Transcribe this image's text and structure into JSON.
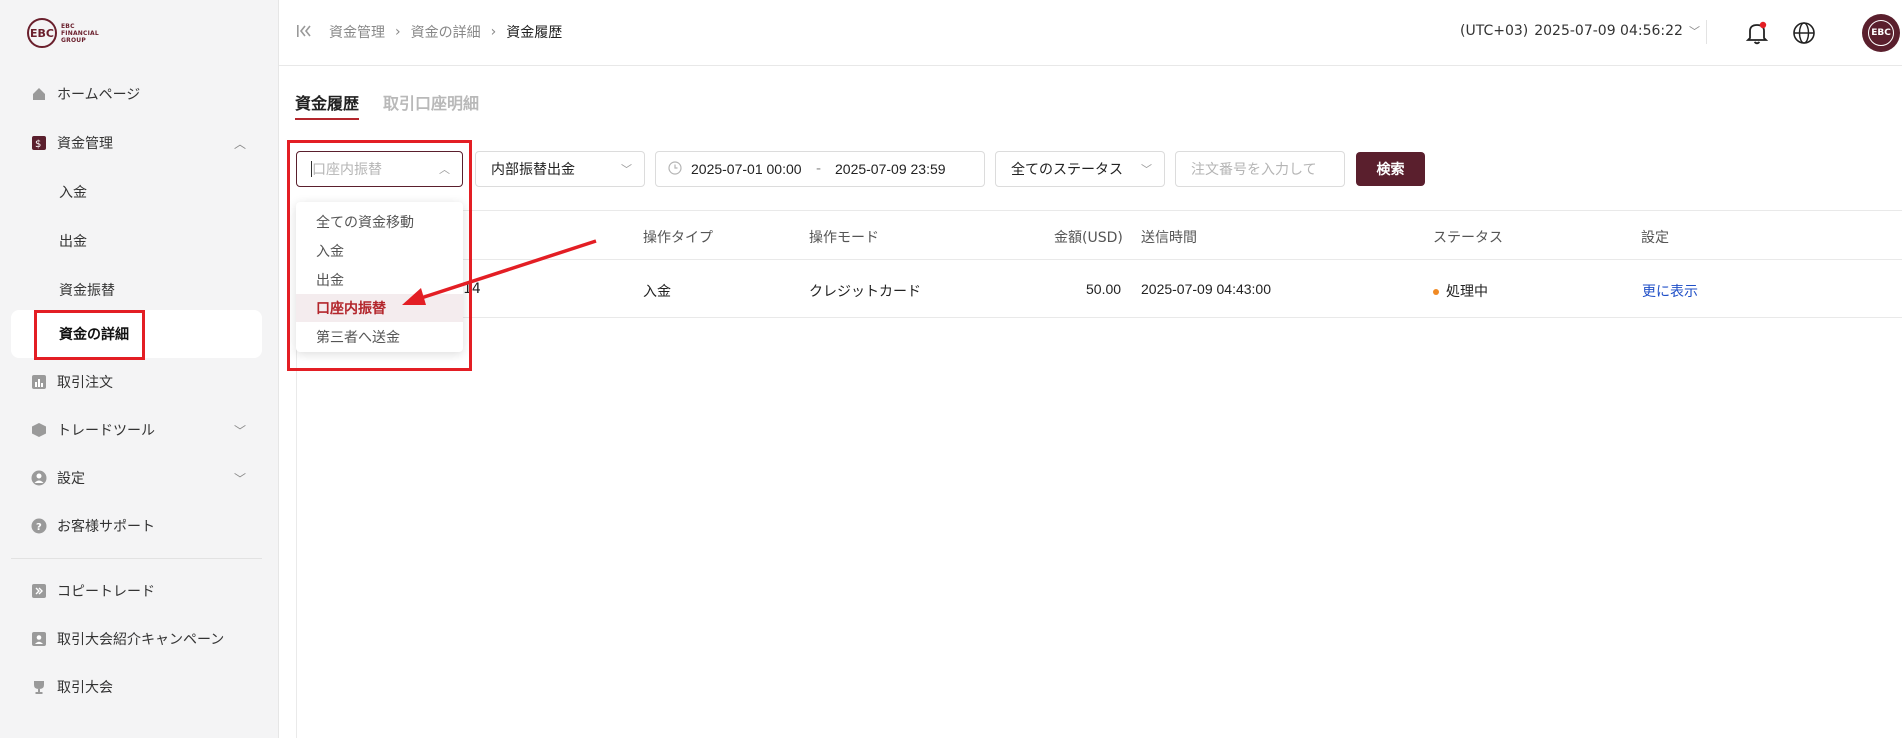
{
  "brand": {
    "logo_mark": "EBC",
    "logo_text": "EBC FINANCIAL GROUP"
  },
  "sidebar": {
    "items": [
      {
        "label": "ホームページ",
        "icon": "home-icon"
      },
      {
        "label": "資金管理",
        "icon": "funds-icon",
        "expanded": true
      },
      {
        "label": "取引注文",
        "icon": "chart-icon"
      },
      {
        "label": "トレードツール",
        "icon": "cube-icon"
      },
      {
        "label": "設定",
        "icon": "user-icon"
      },
      {
        "label": "お客様サポート",
        "icon": "help-icon"
      },
      {
        "label": "コピートレード",
        "icon": "copy-icon"
      },
      {
        "label": "取引大会紹介キャンペーン",
        "icon": "referral-icon"
      },
      {
        "label": "取引大会",
        "icon": "trophy-icon"
      }
    ],
    "sub_items": [
      "入金",
      "出金",
      "資金振替",
      "資金の詳細"
    ],
    "active_sub": "資金の詳細"
  },
  "header": {
    "breadcrumb": [
      "資金管理",
      "資金の詳細",
      "資金履歴"
    ],
    "timezone": "(UTC+03)",
    "datetime": "2025-07-09 04:56:22"
  },
  "tabs": [
    {
      "label": "資金履歴",
      "active": true
    },
    {
      "label": "取引口座明細",
      "active": false
    }
  ],
  "filters": {
    "type_placeholder": "口座内振替",
    "subtype_value": "内部振替出金",
    "date_start": "2025-07-01 00:00",
    "date_sep": "-",
    "date_end": "2025-07-09 23:59",
    "status_value": "全てのステータス",
    "order_placeholder": "注文番号を入力して",
    "search_label": "検索"
  },
  "dropdown": {
    "options": [
      "全ての資金移動",
      "入金",
      "出金",
      "口座内振替",
      "第三者へ送金"
    ],
    "selected": "口座内振替"
  },
  "table": {
    "columns": [
      "操作タイプ",
      "操作モード",
      "金額(USD)",
      "送信時間",
      "ステータス",
      "設定"
    ],
    "rows": [
      {
        "id_fragment": "14",
        "type": "入金",
        "mode": "クレジットカード",
        "amount": "50.00",
        "time": "2025-07-09 04:43:00",
        "status": "処理中",
        "action": "更に表示"
      }
    ]
  },
  "colors": {
    "brand": "#5a1f2d",
    "accent_red": "#b3262c",
    "annotation_red": "#e31e24",
    "status_dot": "#f08a24",
    "link": "#1f4fc7"
  }
}
